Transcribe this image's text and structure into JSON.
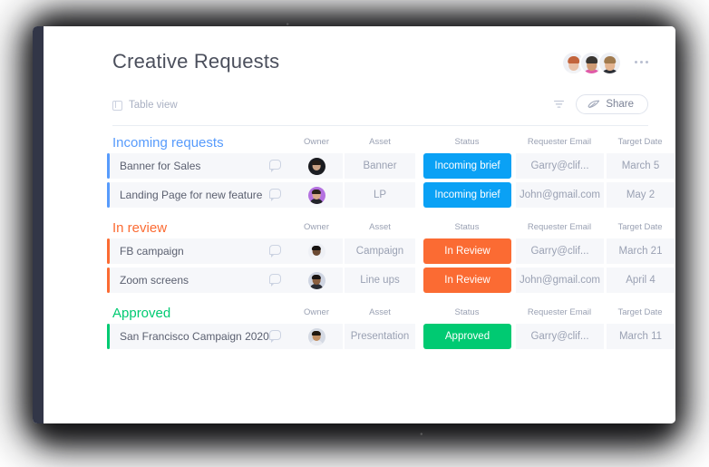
{
  "window": {
    "title": "Creative Requests",
    "rail_color": "#323647"
  },
  "header": {
    "title": "Creative Requests",
    "overflow_menu": "more-options",
    "collaborators": [
      {
        "name": "collaborator-1",
        "skin": "#e8c0a6",
        "hair": "#c2643c",
        "shirt": "#f2f3f6"
      },
      {
        "name": "collaborator-2",
        "skin": "#cf9b74",
        "hair": "#3a3632",
        "shirt": "#e05aa8"
      },
      {
        "name": "collaborator-3",
        "skin": "#e3b491",
        "hair": "#a07a4e",
        "shirt": "#2c2f36"
      }
    ]
  },
  "toolbar": {
    "view_tab_label": "Table view",
    "filter_icon": "filter-icon",
    "share_label": "Share",
    "share_icon": "paper-plane-icon"
  },
  "columns": [
    {
      "key": "owner",
      "label": "Owner",
      "center": 301
    },
    {
      "key": "asset",
      "label": "Asset",
      "center": 371
    },
    {
      "key": "status",
      "label": "Status",
      "center": 467
    },
    {
      "key": "email",
      "label": "Requester Email",
      "center": 569
    },
    {
      "key": "date",
      "label": "Target Date",
      "center": 658
    }
  ],
  "add_column_label": "+",
  "groups": [
    {
      "id": "incoming-requests",
      "title": "Incoming requests",
      "color": "#579bfc",
      "status_color": "#0aa1f5",
      "rows": [
        {
          "name": "Banner for Sales",
          "asset": "Banner",
          "status": "Incoming brief",
          "email": "Garry@clif...",
          "date": "March 5",
          "owner": {
            "name": "owner-avatar",
            "skin": "#caa184",
            "hair": "#241c17",
            "shirt": "#1d1f24",
            "bg": "#1a1b20"
          }
        },
        {
          "name": "Landing Page for new feature",
          "asset": "LP",
          "status": "Incoming brief",
          "email": "John@gmail.com",
          "date": "May 2",
          "owner": {
            "name": "owner-avatar",
            "skin": "#d8a98a",
            "hair": "#2b2118",
            "shirt": "#23242a",
            "bg": "#b471e0"
          }
        }
      ]
    },
    {
      "id": "in-review",
      "title": "In review",
      "color": "#fb6b33",
      "status_color": "#fb6b33",
      "rows": [
        {
          "name": "FB campaign",
          "asset": "Campaign",
          "status": "In Review",
          "email": "Garry@clif...",
          "date": "March 21",
          "owner": {
            "name": "owner-avatar",
            "skin": "#6b4a33",
            "hair": "#171310",
            "shirt": "#f2f3f6",
            "bg": "#eef0f5"
          }
        },
        {
          "name": "Zoom screens",
          "asset": "Line ups",
          "status": "In Review",
          "email": "John@gmail.com",
          "date": "April 4",
          "owner": {
            "name": "owner-avatar",
            "skin": "#8a5f3f",
            "hair": "#1a1512",
            "shirt": "#2a2c33",
            "bg": "#cfd5e2"
          }
        }
      ]
    },
    {
      "id": "approved",
      "title": "Approved",
      "color": "#00ca72",
      "status_color": "#00ca72",
      "rows": [
        {
          "name": "San Francisco Campaign 2020",
          "asset": "Presentation",
          "status": "Approved",
          "email": "Garry@clif...",
          "date": "March 11",
          "owner": {
            "name": "owner-avatar",
            "skin": "#c08f63",
            "hair": "#20180f",
            "shirt": "#e9ebf1",
            "bg": "#d5dae4"
          }
        }
      ]
    }
  ]
}
